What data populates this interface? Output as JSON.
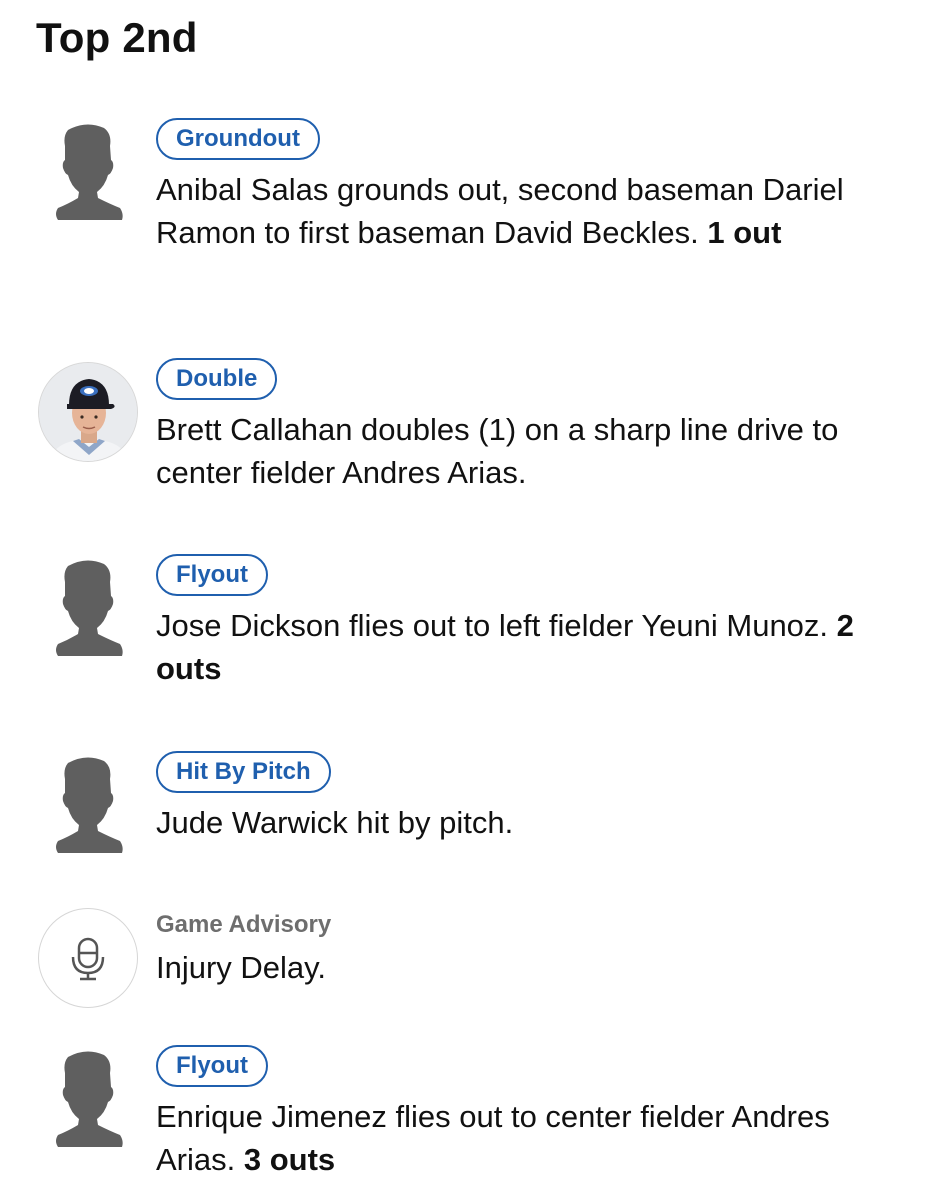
{
  "inning": {
    "title": "Top 2nd"
  },
  "plays": [
    {
      "badge": "Groundout",
      "description": "Anibal Salas grounds out, second baseman Dariel Ramon to first baseman David Beckles.",
      "outs": "1 out",
      "avatar": "silhouette-icon"
    },
    {
      "badge": "Double",
      "description": "Brett Callahan doubles (1) on a sharp line drive to center fielder Andres Arias.",
      "outs": "",
      "avatar": "player-photo"
    },
    {
      "badge": "Flyout",
      "description": "Jose Dickson flies out to left fielder Yeuni Munoz.",
      "outs": "2 outs",
      "avatar": "silhouette-icon"
    },
    {
      "badge": "Hit By Pitch",
      "description": "Jude Warwick hit by pitch.",
      "outs": "",
      "avatar": "silhouette-icon"
    },
    {
      "label": "Game Advisory",
      "description": "Injury Delay.",
      "outs": "",
      "avatar": "microphone-icon"
    },
    {
      "badge": "Flyout",
      "description": "Enrique Jimenez flies out to center fielder Andres Arias.",
      "outs": "3 outs",
      "avatar": "silhouette-icon"
    }
  ],
  "colors": {
    "accent": "#1f5fae",
    "silhouette": "#5f5f5f",
    "muted_label": "#6e6e6e"
  }
}
